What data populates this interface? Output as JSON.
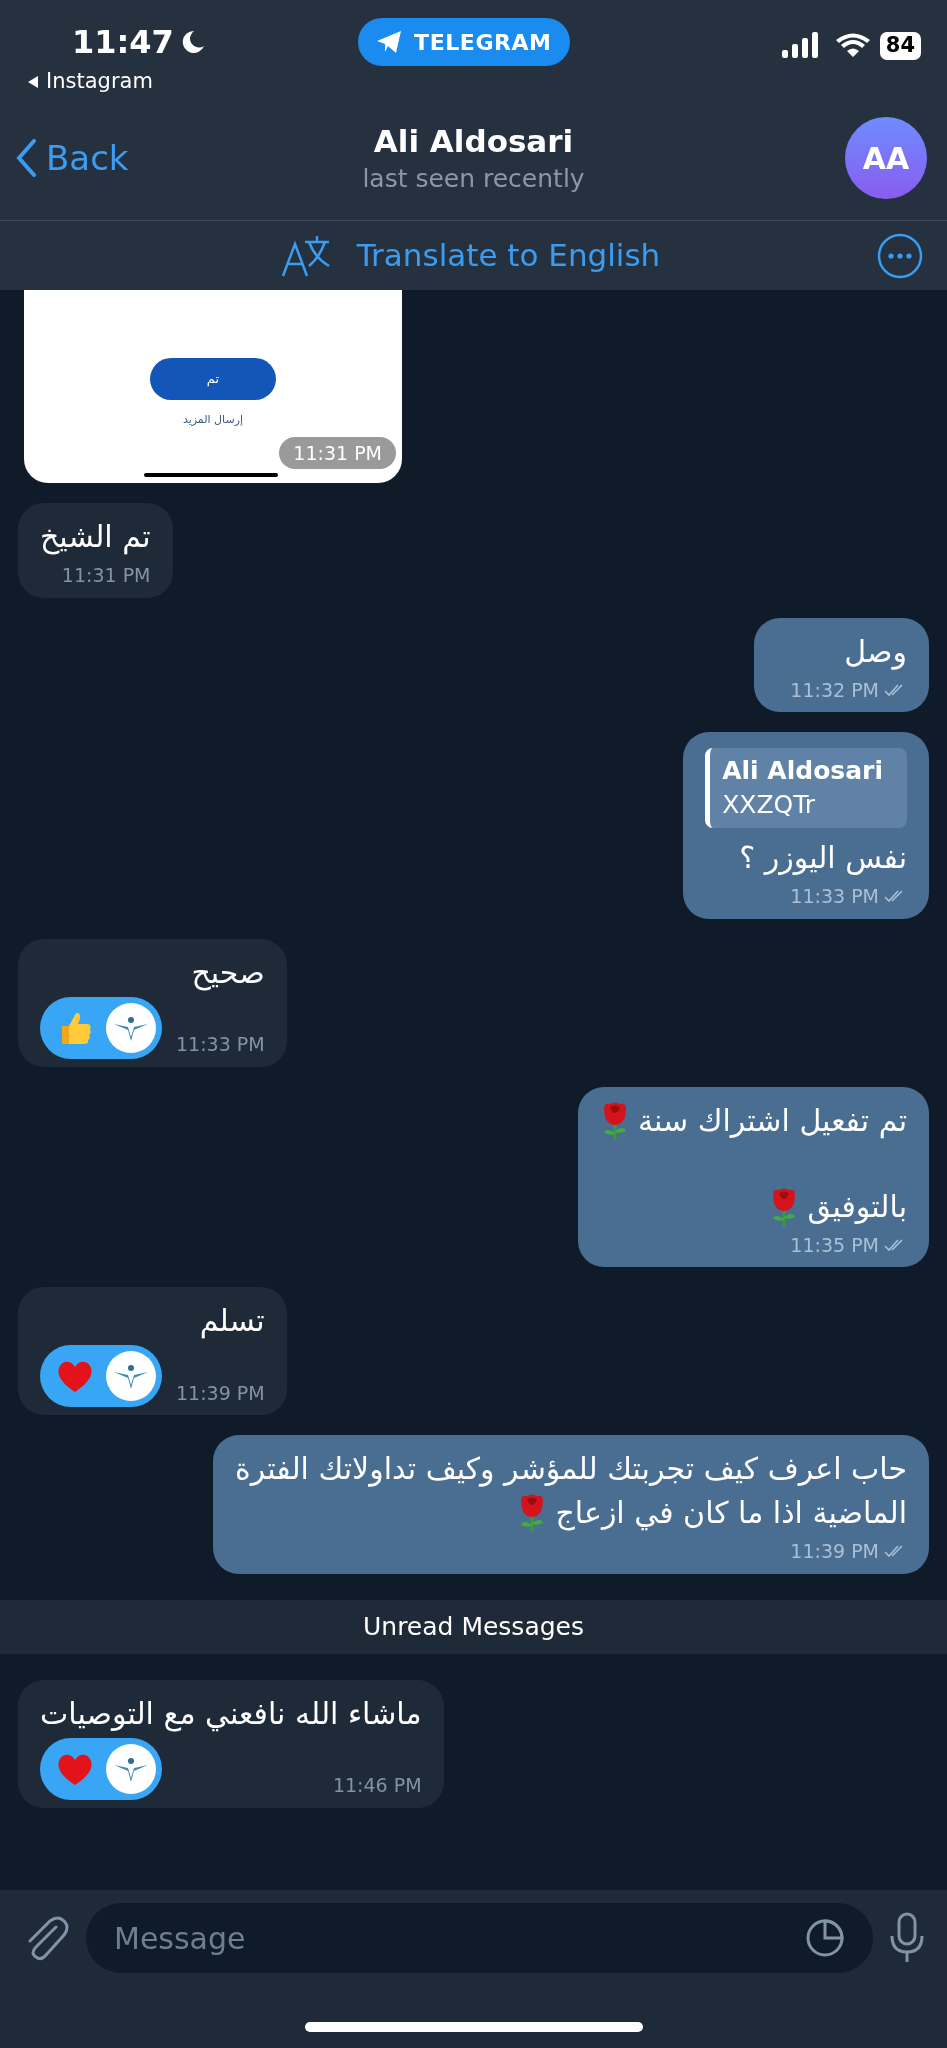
{
  "status_bar": {
    "time": "11:47",
    "back_app": "Instagram",
    "pill": "TELEGRAM",
    "battery": "84"
  },
  "header": {
    "back": "Back",
    "title": "Ali Aldosari",
    "subtitle": "last seen recently",
    "avatar": "AA"
  },
  "translate_bar": {
    "label": "Translate to English"
  },
  "messages": [
    {
      "kind": "image",
      "time": "11:31 PM",
      "screenshot": {
        "button": "تم",
        "link": "إرسال المزيد"
      }
    },
    {
      "kind": "text",
      "outgoing": false,
      "lines": [
        {
          "text": "تم الشيخ"
        }
      ],
      "time": "11:31 PM"
    },
    {
      "kind": "text",
      "outgoing": true,
      "lines": [
        {
          "text": "وصل"
        }
      ],
      "time": "11:32 PM",
      "read": true
    },
    {
      "kind": "reply",
      "outgoing": true,
      "quote": {
        "author": "Ali Aldosari",
        "text": "XXZQTr"
      },
      "lines": [
        {
          "text": "نفس اليوزر ؟"
        }
      ],
      "time": "11:33 PM",
      "read": true
    },
    {
      "kind": "text",
      "outgoing": false,
      "lines": [
        {
          "text": "صحيح"
        }
      ],
      "reactions": [
        {
          "kind": "thumbs_up",
          "selected": true
        }
      ],
      "time": "11:33 PM"
    },
    {
      "kind": "text",
      "outgoing": true,
      "lines": [
        {
          "kind": "text",
          "text": "تم تفعيل اشتراك سنة",
          "emoji": {
            "kind": "rose"
          }
        },
        {
          "kind": "blank"
        },
        {
          "kind": "text",
          "text": "بالتوفيق",
          "emoji": {
            "kind": "rose"
          }
        }
      ],
      "time": "11:35 PM",
      "read": true
    },
    {
      "kind": "text",
      "outgoing": false,
      "lines": [
        {
          "text": "تسلم"
        }
      ],
      "reactions": [
        {
          "kind": "heart",
          "selected": true
        }
      ],
      "time": "11:39 PM"
    },
    {
      "kind": "text",
      "outgoing": true,
      "lines": [
        {
          "text": "حاب اعرف كيف تجربتك للمؤشر وكيف تداولاتك الفترة"
        },
        {
          "kind": "text",
          "text": "الماضية اذا ما كان في ازعاج",
          "emoji": {
            "kind": "rose"
          }
        }
      ],
      "time": "11:39 PM",
      "read": true
    },
    {
      "kind": "divider",
      "label": "Unread Messages"
    },
    {
      "kind": "text",
      "outgoing": false,
      "lines": [
        {
          "text": "ماشاء الله نافعني مع التوصيات"
        }
      ],
      "reactions": [
        {
          "kind": "heart",
          "selected": true
        }
      ],
      "time": "11:46 PM"
    }
  ],
  "composer": {
    "placeholder": "Message"
  }
}
